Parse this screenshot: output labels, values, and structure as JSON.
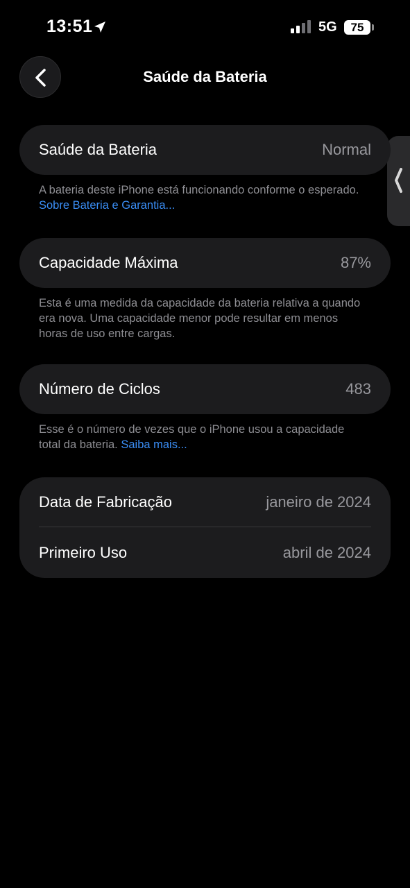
{
  "status_bar": {
    "time": "13:51",
    "network": "5G",
    "battery_level": "75",
    "icons": [
      "location-arrow-icon",
      "signal-bars-icon",
      "battery-icon"
    ]
  },
  "nav": {
    "title": "Saúde da Bateria",
    "back_icon": "chevron-left-icon"
  },
  "sections": {
    "health": {
      "label": "Saúde da Bateria",
      "value": "Normal",
      "footnote": "A bateria deste iPhone está funcionando conforme o esperado.",
      "link": "Sobre Bateria e Garantia..."
    },
    "capacity": {
      "label": "Capacidade Máxima",
      "value": "87%",
      "footnote": "Esta é uma medida da capacidade da bateria relativa a quando era nova. Uma capacidade menor pode resultar em menos horas de uso entre cargas."
    },
    "cycles": {
      "label": "Número de Ciclos",
      "value": "483",
      "footnote": "Esse é o número de vezes que o iPhone usou a capacidade total da bateria.",
      "link": "Saiba mais..."
    },
    "dates": {
      "manufacture_label": "Data de Fabricação",
      "manufacture_value": "janeiro de 2024",
      "first_use_label": "Primeiro Uso",
      "first_use_value": "abril de 2024"
    }
  },
  "colors": {
    "background": "#000000",
    "card": "#1c1c1e",
    "secondary_text": "#8e8e93",
    "link": "#3a8ef6"
  }
}
